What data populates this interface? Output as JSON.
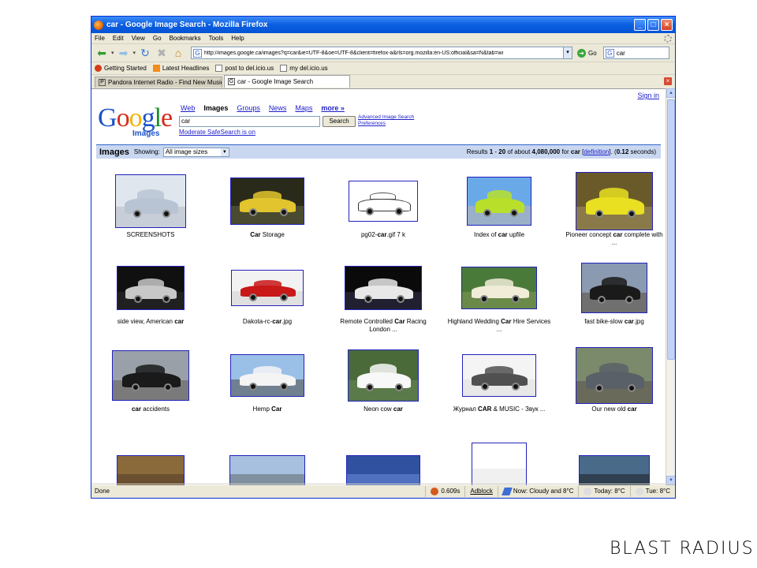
{
  "window": {
    "title": "car - Google Image Search - Mozilla Firefox",
    "buttons": {
      "minimize": "_",
      "maximize": "□",
      "close": "×"
    }
  },
  "menu": [
    "File",
    "Edit",
    "View",
    "Go",
    "Bookmarks",
    "Tools",
    "Help"
  ],
  "nav": {
    "url": "http://images.google.ca/images?q=car&ie=UTF-8&oe=UTF-8&client=firefox-a&rls=org.mozilla:en-US:official&sa=N&tab=wi",
    "go_label": "Go",
    "search_value": "car"
  },
  "bookmarks": [
    "Getting Started",
    "Latest Headlines",
    "post to del.icio.us",
    "my del.icio.us"
  ],
  "tabs": [
    {
      "label": "Pandora Internet Radio - Find New Music, Li...",
      "fav": "P"
    },
    {
      "label": "car - Google Image Search",
      "fav": "G"
    }
  ],
  "google": {
    "sign_in": "Sign in",
    "logo_word": [
      "G",
      "o",
      "o",
      "g",
      "l",
      "e"
    ],
    "logo_sub": "Images",
    "nav": [
      "Web",
      "Images",
      "Groups",
      "News",
      "Maps",
      "more »"
    ],
    "query": "car",
    "search_button": "Search",
    "advanced": "Advanced Image Search",
    "preferences": "Preferences",
    "safesearch": "Moderate SafeSearch is on",
    "bar_label": "Images",
    "showing": "Showing:",
    "size_option": "All image sizes",
    "results": {
      "prefix": "Results ",
      "range_start": "1",
      "dash": " - ",
      "range_end": "20",
      "of_about": " of about ",
      "total": "4,080,000",
      "for": " for ",
      "term": "car",
      "definition": "definition",
      "time": "0.12",
      "seconds": " seconds)"
    }
  },
  "results": [
    {
      "pre": "SCREENSHOTS",
      "bold": "",
      "post": "",
      "line2": "",
      "colors": [
        "#dfe6ee",
        "#b8c4d4",
        "#c8ced8"
      ]
    },
    {
      "pre": "",
      "bold": "Car",
      "post": " Storage",
      "line2": "",
      "colors": [
        "#2a2a1a",
        "#e2c52e",
        "#4a4a30"
      ]
    },
    {
      "pre": "pg02-",
      "bold": "car",
      "post": ".gif 7 k",
      "line2": "",
      "colors": [
        "#ffffff",
        "#ffffff",
        "#ffffff"
      ]
    },
    {
      "pre": "Index of ",
      "bold": "car",
      "post": " upfile",
      "line2": "",
      "colors": [
        "#6aa9e8",
        "#b8e02a",
        "#9ab0c8"
      ]
    },
    {
      "pre": "Pioneer concept ",
      "bold": "car",
      "post": " complete with",
      "line2": "...",
      "colors": [
        "#6a5a2a",
        "#e8e020",
        "#8a7a4a"
      ]
    },
    {
      "pre": "side view, American ",
      "bold": "car",
      "post": "",
      "line2": "",
      "colors": [
        "#101010",
        "#c8c8c8",
        "#202020"
      ]
    },
    {
      "pre": "Dakota-rc-",
      "bold": "car",
      "post": ".jpg",
      "line2": "",
      "colors": [
        "#f2f2f2",
        "#c81818",
        "#e0e0e0"
      ]
    },
    {
      "pre": "Remote Controlled ",
      "bold": "Car",
      "post": " Racing",
      "line2": "London ...",
      "colors": [
        "#0a0a0a",
        "#e8e8e8",
        "#202030"
      ]
    },
    {
      "pre": "Highland Wedding ",
      "bold": "Car",
      "post": " Hire Services",
      "line2": "...",
      "colors": [
        "#4a7a3a",
        "#f0ecd8",
        "#6a8a4a"
      ]
    },
    {
      "pre": "fast bike-slow ",
      "bold": "car",
      "post": ".jpg",
      "line2": "",
      "colors": [
        "#8a9ab0",
        "#1a1a1a",
        "#707070"
      ]
    },
    {
      "pre": "",
      "bold": "car",
      "post": " accidents",
      "line2": "",
      "colors": [
        "#9aa0a8",
        "#1a1a1a",
        "#7a7a7a"
      ]
    },
    {
      "pre": "Hemp ",
      "bold": "Car",
      "post": "",
      "line2": "",
      "colors": [
        "#9ac0e8",
        "#f4f4f4",
        "#708090"
      ]
    },
    {
      "pre": "Neon cow ",
      "bold": "car",
      "post": "",
      "line2": "",
      "colors": [
        "#4a6a3a",
        "#f8f8f8",
        "#5a7a4a"
      ]
    },
    {
      "pre": "Журнал ",
      "bold": "CAR",
      "post": " & MUSIC - Звук ...",
      "line2": "",
      "colors": [
        "#f4f4f4",
        "#505050",
        "#e8e8e8"
      ]
    },
    {
      "pre": "Our new old ",
      "bold": "car",
      "post": "",
      "line2": "",
      "colors": [
        "#7a8a6a",
        "#5a6068",
        "#6a6a5a"
      ]
    },
    {
      "pre": "",
      "bold": "",
      "post": "",
      "line2": "",
      "colors": [
        "#8a6a3a",
        "#c0a070",
        "#6a5030"
      ]
    },
    {
      "pre": "",
      "bold": "",
      "post": "",
      "line2": "",
      "colors": [
        "#a8c0e0",
        "#c8d8f0",
        "#8090a0"
      ]
    },
    {
      "pre": "",
      "bold": "",
      "post": "",
      "line2": "",
      "colors": [
        "#3050a0",
        "#e0e0f0",
        "#5070c0"
      ]
    },
    {
      "pre": "",
      "bold": "",
      "post": "",
      "line2": "",
      "colors": [
        "#ffffff",
        "#808080",
        "#f0f0f0"
      ]
    },
    {
      "pre": "",
      "bold": "",
      "post": "",
      "line2": "",
      "colors": [
        "#4a6a8a",
        "#8aa0b0",
        "#304050"
      ]
    }
  ],
  "status": {
    "done": "Done",
    "time": "0.609s",
    "adblock": "Adblock",
    "now": "Now: Cloudy and 8°C",
    "today": "Today: 8°C",
    "tue": "Tue: 8°C"
  },
  "watermark": "BLAST RADIUS"
}
